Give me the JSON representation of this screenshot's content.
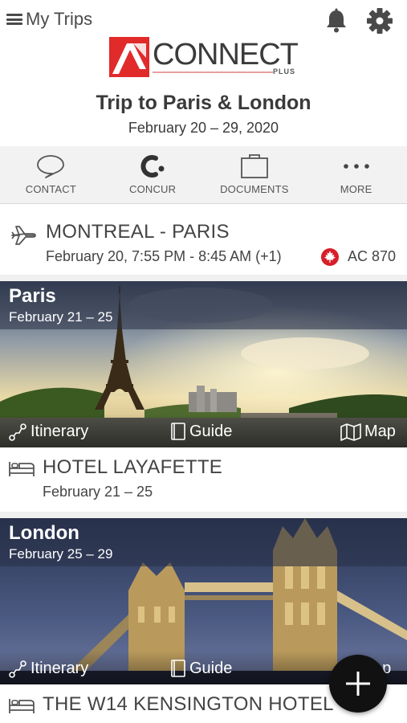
{
  "header": {
    "back_label": "My Trips",
    "icons": [
      "menu-icon",
      "bell-icon",
      "gear-icon"
    ]
  },
  "logo": {
    "text": "CONNECT",
    "sub": "PLUS",
    "brand_color": "#e12a2a"
  },
  "trip": {
    "title": "Trip to Paris & London",
    "dates": "February 20 – 29, 2020"
  },
  "toolbar": {
    "items": [
      {
        "label": "CONTACT",
        "icon": "chat-bubble-icon"
      },
      {
        "label": "CONCUR",
        "icon": "concur-icon"
      },
      {
        "label": "DOCUMENTS",
        "icon": "briefcase-icon"
      },
      {
        "label": "MORE",
        "icon": "more-dots-icon"
      }
    ]
  },
  "flight": {
    "route": "MONTREAL - PARIS",
    "times": "February 20, 7:55 PM - 8:45 AM (+1)",
    "flight_number": "AC 870",
    "airline_icon": "maple-leaf-icon",
    "airline_color": "#d81e28"
  },
  "destinations": [
    {
      "city": "Paris",
      "dates": "February 21 – 25",
      "actions": {
        "itinerary": "Itinerary",
        "guide": "Guide",
        "map": "Map"
      }
    },
    {
      "city": "London",
      "dates": "February 25 – 29",
      "actions": {
        "itinerary": "Itinerary",
        "guide": "Guide",
        "map": "ap"
      }
    }
  ],
  "hotels": [
    {
      "name": "HOTEL LAYAFETTE",
      "dates": "February 21 – 25"
    },
    {
      "name": "THE W14 KENSINGTON HOTEL",
      "dates": ""
    }
  ],
  "fab": {
    "icon": "plus-icon"
  }
}
